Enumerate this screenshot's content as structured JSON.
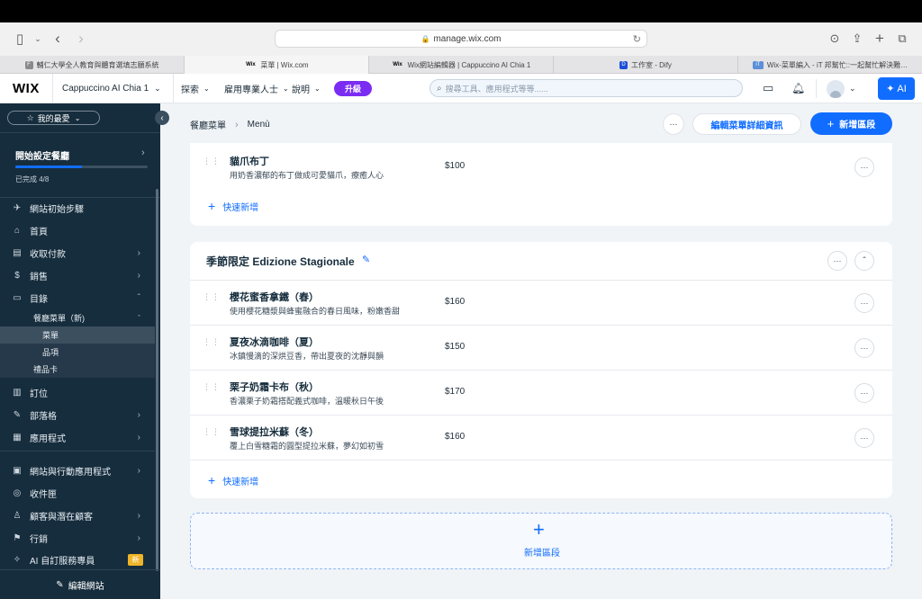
{
  "browser": {
    "url": "manage.wix.com",
    "tabs": [
      {
        "label": "輔仁大學全人教育與體育選填志願系統",
        "fav_color": "#8a8a8a",
        "fav_text": "F"
      },
      {
        "label": "菜單 | Wix.com",
        "fav_color": "#000000",
        "fav_text": "Wix"
      },
      {
        "label": "Wix網站編輯器 | Cappuccino AI Chia 1",
        "fav_color": "#000000",
        "fav_text": "Wix"
      },
      {
        "label": "工作室 - Dify",
        "fav_color": "#1d4ed8",
        "fav_text": "D"
      },
      {
        "label": "Wix-菜單編入 - iT 邦幫忙::一起幫忙解決難…",
        "fav_color": "#5b8fd6",
        "fav_text": "iT"
      }
    ]
  },
  "wix": {
    "logo": "WIX",
    "site_name": "Cappuccino AI Chia 1",
    "menu": [
      "探索",
      "雇用專業人士",
      "說明"
    ],
    "upgrade": "升級",
    "search_placeholder": "搜尋工具、應用程式等等......",
    "ai_label": "AI"
  },
  "sidebar": {
    "favorites": "我的最愛",
    "setup_title": "開始設定餐廳",
    "progress_text": "已完成 4/8",
    "progress_value": 0.5,
    "items": [
      {
        "label": "網站初始步驟",
        "icon": "rocket-icon",
        "glyph": "✈",
        "chev": ""
      },
      {
        "label": "首頁",
        "icon": "home-icon",
        "glyph": "⌂",
        "chev": ""
      },
      {
        "label": "收取付款",
        "icon": "payment-icon",
        "glyph": "▤",
        "chev": "›"
      },
      {
        "label": "銷售",
        "icon": "sales-icon",
        "glyph": "$",
        "chev": "›"
      },
      {
        "label": "目錄",
        "icon": "catalog-icon",
        "glyph": "▭",
        "chev": "ˆ"
      }
    ],
    "catalog_sub": {
      "parent": "餐廳菜單（新)",
      "children": [
        "菜單",
        "品項"
      ],
      "gift": "禮品卡"
    },
    "items2": [
      {
        "label": "訂位",
        "icon": "reservation-icon",
        "glyph": "▥",
        "chev": ""
      },
      {
        "label": "部落格",
        "icon": "blog-icon",
        "glyph": "✎",
        "chev": "›"
      },
      {
        "label": "應用程式",
        "icon": "apps-icon",
        "glyph": "▦",
        "chev": "›"
      },
      {
        "label": "網站與行動應用程式",
        "icon": "site-app-icon",
        "glyph": "▣",
        "chev": "›"
      },
      {
        "label": "收件匣",
        "icon": "inbox-icon",
        "glyph": "◎",
        "chev": ""
      },
      {
        "label": "顧客與潛在顧客",
        "icon": "customers-icon",
        "glyph": "♙",
        "chev": "›"
      },
      {
        "label": "行銷",
        "icon": "marketing-icon",
        "glyph": "⚑",
        "chev": "›"
      },
      {
        "label": "AI 自訂服務專員",
        "icon": "ai-agent-icon",
        "glyph": "✧",
        "chev": "",
        "badge": "新"
      }
    ],
    "edit_site": "編輯網站"
  },
  "main": {
    "breadcrumb": [
      "餐廳菜單",
      "Menù"
    ],
    "edit_details": "編輯菜單詳細資訊",
    "add_section": "新增區段",
    "prev_item": {
      "name": "貓爪布丁",
      "desc": "用奶香濃郁的布丁做成可愛貓爪，療癒人心",
      "price": "$100"
    },
    "quick_add": "快速新增",
    "section_title": "季節限定 Edizione Stagionale",
    "items": [
      {
        "name": "櫻花蜜香拿鐵（春）",
        "desc": "使用櫻花糖漿與蜂蜜融合的春日風味，粉嫩香甜",
        "price": "$160"
      },
      {
        "name": "夏夜冰滴咖啡（夏）",
        "desc": "冰鎮慢滴的深烘豆香，帶出夏夜的沈靜與韻",
        "price": "$150"
      },
      {
        "name": "栗子奶霜卡布（秋）",
        "desc": "香濃栗子奶霜搭配義式咖啡，溫暖秋日午後",
        "price": "$170"
      },
      {
        "name": "雪球提拉米蘇（冬）",
        "desc": "覆上白雪糖霜的圓型提拉米蘇，夢幻如初雪",
        "price": "$160"
      }
    ],
    "add_section_box": "新增區段"
  },
  "colors": {
    "accent": "#116dff",
    "sidebar": "#162d3d",
    "upgrade": "#7b2cf2"
  }
}
